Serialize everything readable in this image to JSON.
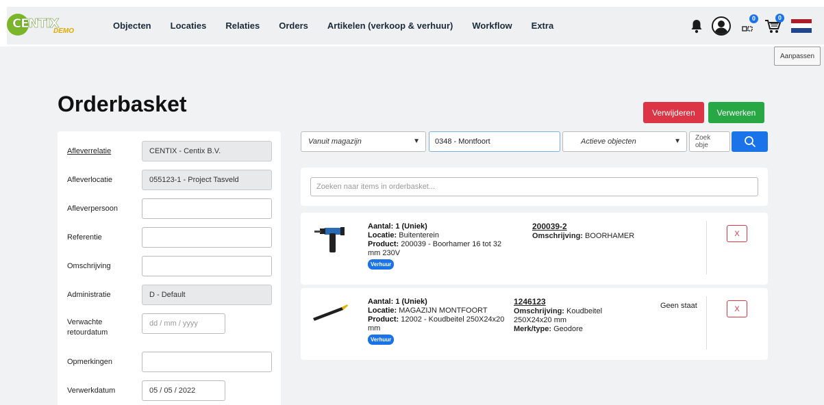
{
  "brand": {
    "name": "CENTIX",
    "sub": "DEMO",
    "accent": "#7ab52a"
  },
  "nav": {
    "items": [
      "Objecten",
      "Locaties",
      "Relaties",
      "Orders",
      "Artikelen (verkoop & verhuur)",
      "Workflow",
      "Extra"
    ],
    "icons": [
      "bell-icon",
      "user-icon",
      "scan-icon",
      "cart-icon",
      "flag-nl-icon"
    ],
    "scan_badge": "0",
    "cart_badge": "0"
  },
  "aanpassen_label": "Aanpassen",
  "page": {
    "title": "Orderbasket"
  },
  "actions": {
    "remove": "Verwijderen",
    "process": "Verwerken"
  },
  "form": {
    "fields": [
      {
        "label": "Afleverrelatie",
        "value": "CENTIX - Centix B.V.",
        "readonly": true,
        "link": true
      },
      {
        "label": "Afleverlocatie",
        "value": "055123-1 - Project Tasveld",
        "readonly": true,
        "link": false
      },
      {
        "label": "Afleverpersoon",
        "value": "",
        "readonly": false,
        "link": false
      },
      {
        "label": "Referentie",
        "value": "",
        "readonly": false,
        "link": false
      },
      {
        "label": "Omschrijving",
        "value": "",
        "readonly": false,
        "link": false
      },
      {
        "label": "Administratie",
        "value": "D - Default",
        "readonly": true,
        "link": false
      },
      {
        "label": "Verwachte retourdatum",
        "value": "dd / mm / yyyy",
        "readonly": false,
        "link": false
      },
      {
        "label": "Opmerkingen",
        "value": "",
        "readonly": false,
        "link": false
      },
      {
        "label": "Verwerkdatum",
        "value": "05 / 05 / 2022",
        "readonly": false,
        "link": false
      }
    ]
  },
  "filters": {
    "warehouse_placeholder": "Vanuit magazijn",
    "warehouse_value": "0348 - Montfoort",
    "objects_placeholder": "Actieve objecten",
    "search_placeholder": "Zoek obje"
  },
  "basket_search_placeholder": "Zoeken naar items in orderbasket...",
  "items": [
    {
      "aantal": "Aantal: 1 (Uniek)",
      "locatie_label": "Locatie:",
      "locatie": "Buitenterein",
      "product_label": "Product:",
      "product": "200039 - Boorhamer 16 tot 32 mm 230V",
      "tag": "Verhuur",
      "code": "200039-2",
      "omschr_label": "Omschrijving:",
      "omschr": "BOORHAMER",
      "merk_label": "",
      "merk": "",
      "state": "",
      "remove": "X"
    },
    {
      "aantal": "Aantal: 1 (Uniek)",
      "locatie_label": "Locatie:",
      "locatie": "MAGAZIJN MONTFOORT",
      "product_label": "Product:",
      "product": "12002 - Koudbeitel 250X24x20 mm",
      "tag": "Verhuur",
      "code": "1246123",
      "omschr_label": "Omschrijving:",
      "omschr": "Koudbeitel 250X24x20 mm",
      "merk_label": "Merk/type:",
      "merk": "Geodore",
      "state": "Geen staat",
      "remove": "X"
    }
  ]
}
